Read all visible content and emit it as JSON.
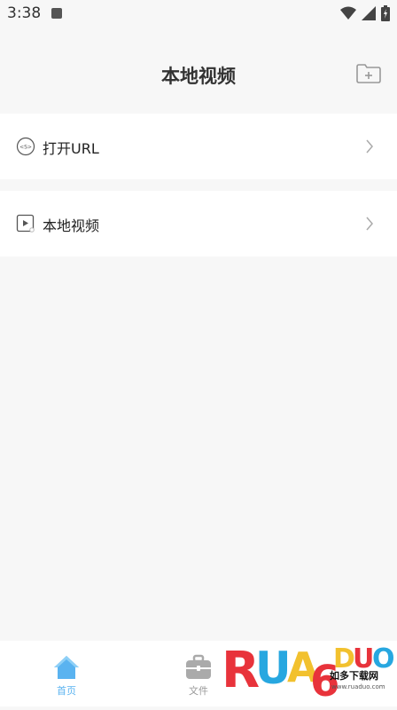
{
  "status_bar": {
    "time": "3:38",
    "icons": [
      "a-icon",
      "wifi-icon",
      "signal-icon",
      "battery-icon"
    ]
  },
  "header": {
    "title": "本地视频",
    "action_icon": "folder-add-icon"
  },
  "items": [
    {
      "label": "打开URL",
      "icon": "url-link-icon"
    },
    {
      "label": "本地视频",
      "icon": "video-file-icon"
    }
  ],
  "tabbar": {
    "tabs": [
      {
        "label": "首页",
        "icon": "home-icon",
        "active": true
      },
      {
        "label": "文件",
        "icon": "toolbox-icon",
        "active": false
      }
    ],
    "active_color": "#5ab3f0",
    "inactive_color": "#999999"
  },
  "watermark": {
    "brand": "RUANDUO",
    "sub": "如多下载网",
    "url": "www.ruaduo.com"
  }
}
